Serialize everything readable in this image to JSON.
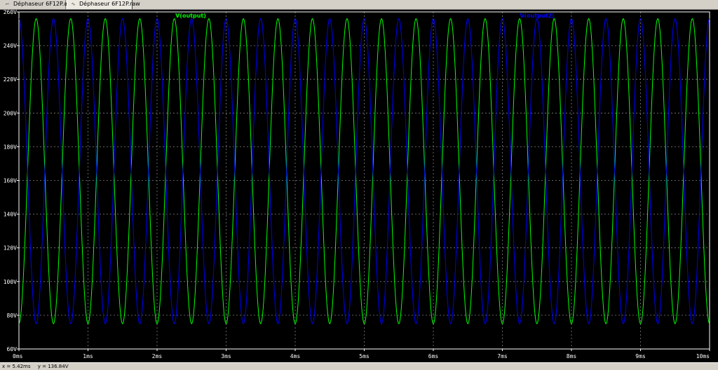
{
  "tabs": [
    {
      "label": "Déphaseur 6F12P.asc",
      "icon": "schematic-icon"
    },
    {
      "label": "Déphaseur 6F12P.raw",
      "icon": "waveform-icon",
      "active": true
    }
  ],
  "status": {
    "x": "x = 5.42ms",
    "y": "y = 136.84V"
  },
  "chart_data": {
    "type": "line",
    "title": "",
    "xlabel": "",
    "ylabel": "",
    "xlim": [
      0,
      10
    ],
    "ylim": [
      60,
      260
    ],
    "grid": true,
    "background": "#000000",
    "grid_color": "#808080",
    "x_ticks": [
      0,
      1,
      2,
      3,
      4,
      5,
      6,
      7,
      8,
      9,
      10
    ],
    "x_tick_labels": [
      "0ms",
      "1ms",
      "2ms",
      "3ms",
      "4ms",
      "5ms",
      "6ms",
      "7ms",
      "8ms",
      "9ms",
      "10ms"
    ],
    "y_ticks": [
      60,
      80,
      100,
      120,
      140,
      160,
      180,
      200,
      220,
      240,
      260
    ],
    "y_tick_labels": [
      "60V",
      "80V",
      "100V",
      "120V",
      "140V",
      "160V",
      "180V",
      "200V",
      "220V",
      "240V",
      "260V"
    ],
    "series": [
      {
        "name": "V(output)",
        "color": "#00ff00",
        "offset": 165.5,
        "amplitude": 90.5,
        "period_ms": 0.5,
        "peak_ms": 0.25
      },
      {
        "name": "V(output2)",
        "color": "#0000ff",
        "offset": 165.5,
        "amplitude": 90.5,
        "period_ms": 0.5,
        "peak_ms": 0.0
      }
    ]
  }
}
